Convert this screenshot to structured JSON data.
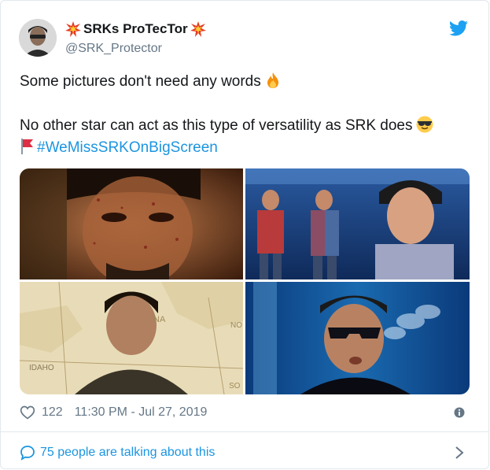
{
  "author": {
    "display_name": "SRKs ProTecTor",
    "handle": "@SRK_Protector"
  },
  "tweet": {
    "line1": "Some pictures don't need any words",
    "line2": "No other star can act as this type of versatility as SRK does",
    "hashtag": "#WeMissSRKOnBigScreen"
  },
  "media": {
    "map_labels": {
      "idaho": "IDAHO",
      "na": "NA",
      "no": "NO",
      "so": "SO"
    }
  },
  "meta": {
    "likes": "122",
    "timestamp": "11:30 PM - Jul 27, 2019"
  },
  "footer": {
    "conversation": "75 people are talking about this"
  },
  "colors": {
    "link": "#1b95e0",
    "secondary_text": "#657786",
    "border": "#e1e8ed"
  }
}
